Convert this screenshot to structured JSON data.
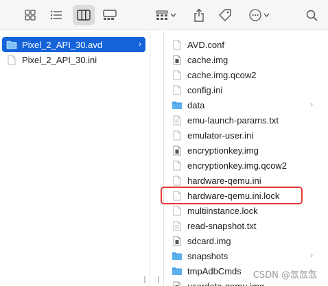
{
  "toolbar": {
    "icons": [
      "icon-view-grid-icon",
      "list-view-icon",
      "column-view-icon",
      "gallery-view-icon",
      "group-icon",
      "share-icon",
      "tag-icon",
      "more-icon",
      "search-icon"
    ],
    "active_view": "column-view"
  },
  "left_column": {
    "items": [
      {
        "label": "Pixel_2_API_30.avd",
        "type": "folder",
        "selected": true
      },
      {
        "label": "Pixel_2_API_30.ini",
        "type": "file",
        "selected": false
      }
    ]
  },
  "right_column": {
    "items": [
      {
        "label": "AVD.conf",
        "type": "file"
      },
      {
        "label": "cache.img",
        "type": "binary"
      },
      {
        "label": "cache.img.qcow2",
        "type": "file"
      },
      {
        "label": "config.ini",
        "type": "file"
      },
      {
        "label": "data",
        "type": "folder"
      },
      {
        "label": "emu-launch-params.txt",
        "type": "text"
      },
      {
        "label": "emulator-user.ini",
        "type": "file"
      },
      {
        "label": "encryptionkey.img",
        "type": "binary"
      },
      {
        "label": "encryptionkey.img.qcow2",
        "type": "file"
      },
      {
        "label": "hardware-qemu.ini",
        "type": "file"
      },
      {
        "label": "hardware-qemu.ini.lock",
        "type": "file",
        "highlighted": true
      },
      {
        "label": "multiinstance.lock",
        "type": "file"
      },
      {
        "label": "read-snapshot.txt",
        "type": "text"
      },
      {
        "label": "sdcard.img",
        "type": "binary"
      },
      {
        "label": "snapshots",
        "type": "folder"
      },
      {
        "label": "tmpAdbCmds",
        "type": "folder"
      },
      {
        "label": "userdata-qemu.img",
        "type": "binary"
      }
    ]
  },
  "colors": {
    "accent": "#1463d8",
    "folder": "#4aa0e6",
    "highlight": "#e53935"
  },
  "watermark": "CSDN @氙氙氙"
}
